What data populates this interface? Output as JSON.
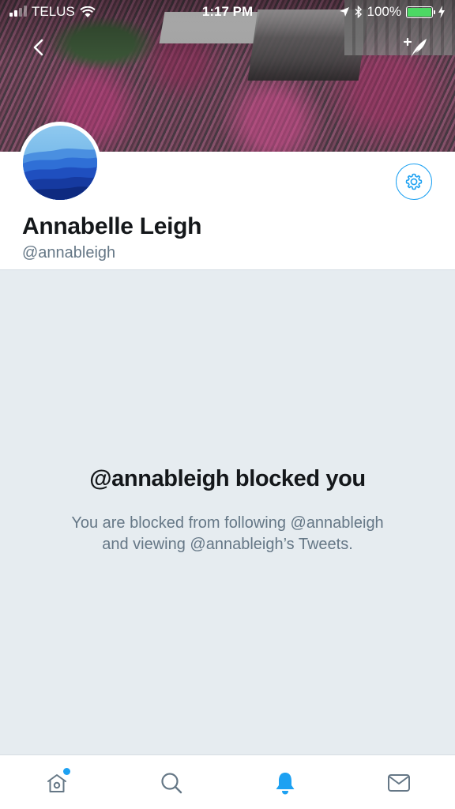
{
  "status_bar": {
    "carrier": "TELUS",
    "time": "1:17 PM",
    "battery_percent": "100%"
  },
  "profile": {
    "display_name": "Annabelle Leigh",
    "handle": "@annableigh"
  },
  "blocked": {
    "title": "@annableigh blocked you",
    "line1": "You are blocked from following @annableigh",
    "line2": "and viewing @annableigh’s Tweets."
  },
  "icons": {
    "back": "back-icon",
    "compose": "compose-tweet-icon",
    "settings": "gear-icon",
    "home": "home-icon",
    "search": "search-icon",
    "notifications": "bell-icon",
    "messages": "envelope-icon"
  },
  "colors": {
    "accent": "#1da1f2",
    "background": "#e6ecf0",
    "primary_text": "#14171a",
    "secondary_text": "#657786",
    "battery": "#4cd964"
  },
  "tab_bar": {
    "active_tab": "notifications"
  }
}
